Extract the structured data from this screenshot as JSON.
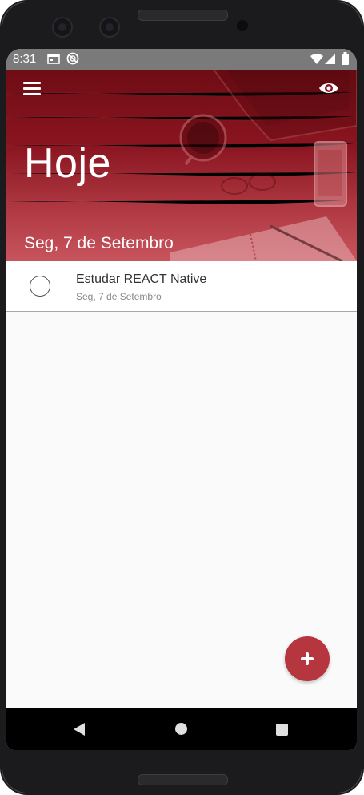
{
  "status_bar": {
    "time": "8:31",
    "icons": [
      "calendar-notification-icon",
      "no-disturb-icon",
      "wifi-icon",
      "signal-icon",
      "battery-icon"
    ]
  },
  "header": {
    "title": "Hoje",
    "subtitle": "Seg, 7 de Setembro",
    "menu_icon": "menu-icon",
    "toggle_icon": "eye-icon"
  },
  "tasks": [
    {
      "title": "Estudar REACT Native",
      "date": "Seg, 7 de Setembro",
      "done": false
    }
  ],
  "fab": {
    "icon": "plus-icon"
  },
  "nav_bar": {
    "icons": [
      "back-icon",
      "home-icon",
      "recents-icon"
    ]
  },
  "colors": {
    "header_dark": "#6f0c14",
    "header_light": "#c8545d",
    "fab": "#b5363f",
    "status_bar": "#7a7a7a"
  }
}
